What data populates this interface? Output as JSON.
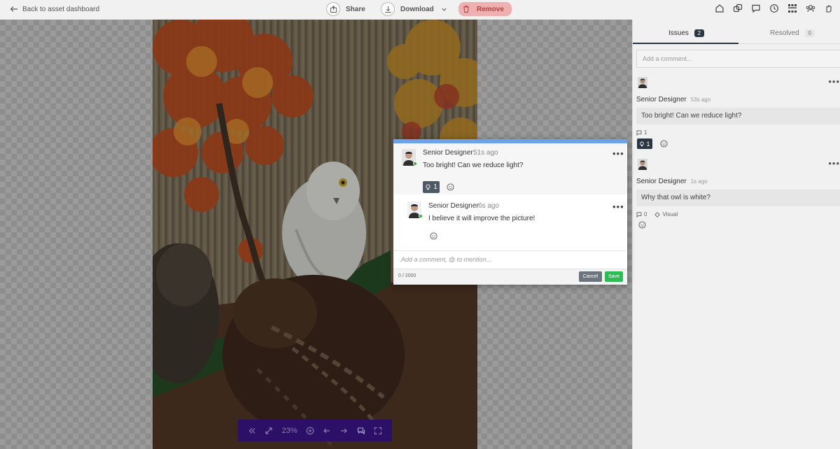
{
  "topbar": {
    "back_label": "Back to asset dashboard",
    "share_label": "Share",
    "download_label": "Download",
    "remove_label": "Remove",
    "right_icons": [
      "home-icon",
      "copy-icon",
      "chat-icon",
      "clock-icon",
      "qr-code-icon",
      "team-icon",
      "hand-icon"
    ]
  },
  "zoom_bar": {
    "zoom_level": "23%",
    "icons": [
      "collapse-icon",
      "fit-icon",
      "zoom-in-icon",
      "prev-icon",
      "next-icon",
      "comments-icon",
      "fullscreen-icon"
    ]
  },
  "panel": {
    "tabs": [
      {
        "label": "Issues",
        "count": "2"
      },
      {
        "label": "Resolved",
        "count": "0"
      }
    ],
    "comment_placeholder": "Add a comment...",
    "threads": [
      {
        "author": "Senior Designer",
        "time": "53s ago",
        "text": "Too bright! Can we reduce light?",
        "reply_count": "1",
        "reaction_count": "1"
      },
      {
        "author": "Senior Designer",
        "time": "1s ago",
        "text": "Why that owl is white?",
        "reply_count": "0",
        "tag": "Visual"
      }
    ]
  },
  "popup": {
    "comment": {
      "author": "Senior Designer",
      "time": "51s ago",
      "text": "Too bright! Can we reduce light?",
      "reaction_count": "1"
    },
    "reply": {
      "author": "Senior Designer",
      "time": "6s ago",
      "text": "I believe it will improve the picture!"
    },
    "input_placeholder": "Add a comment, @ to mention...",
    "char_count": "0 / 2000",
    "cancel_label": "Cancel",
    "save_label": "Save"
  },
  "colors": {
    "accent_blue": "#6ca2ea",
    "remove_bg": "#eeb0b0",
    "zoom_bar_bg": "#2c0f66",
    "online_green": "#3cb043",
    "save_green": "#2dbb53"
  }
}
